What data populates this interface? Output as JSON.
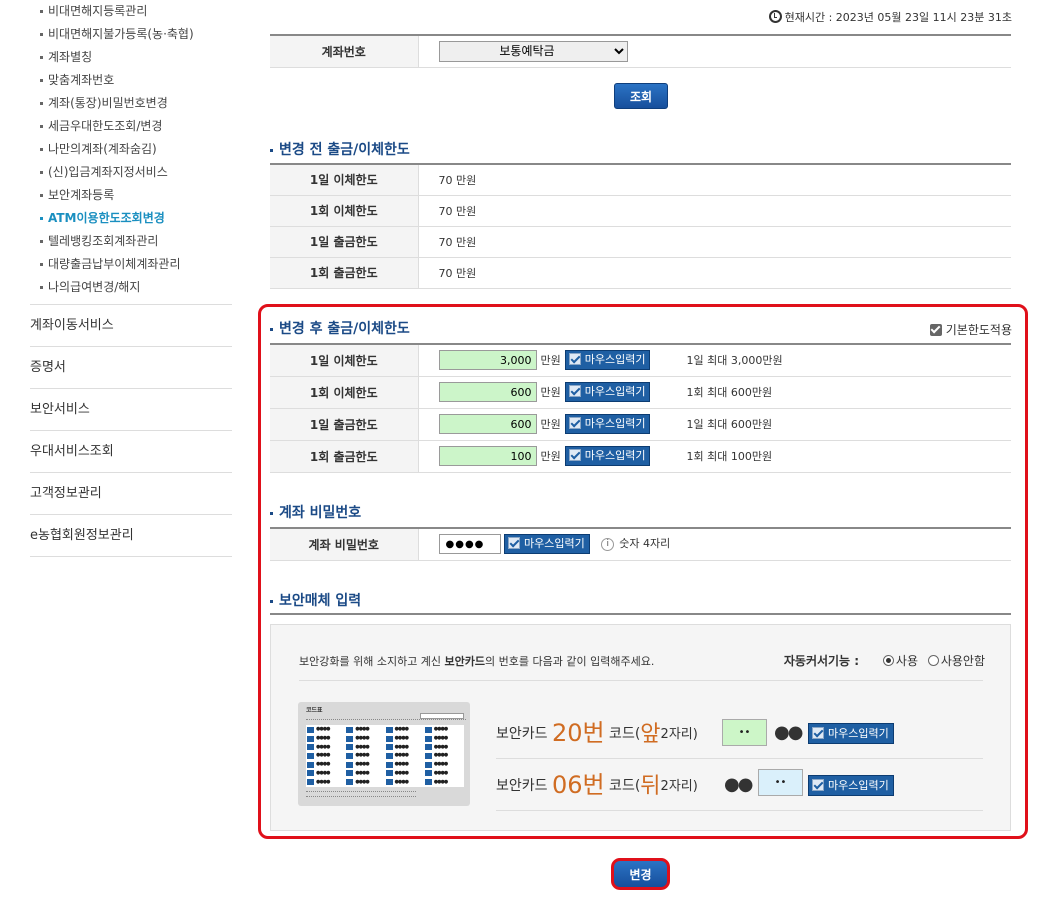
{
  "sidebar": {
    "sub_items": [
      {
        "label": "비대면해지등록관리",
        "active": false
      },
      {
        "label": "비대면해지불가등록(농·축협)",
        "active": false
      },
      {
        "label": "계좌별칭",
        "active": false
      },
      {
        "label": "맞춤계좌번호",
        "active": false
      },
      {
        "label": "계좌(통장)비밀번호변경",
        "active": false
      },
      {
        "label": "세금우대한도조회/변경",
        "active": false
      },
      {
        "label": "나만의계좌(계좌숨김)",
        "active": false
      },
      {
        "label": "(신)입금계좌지정서비스",
        "active": false
      },
      {
        "label": "보안계좌등록",
        "active": false
      },
      {
        "label": "ATM이용한도조회변경",
        "active": true
      },
      {
        "label": "텔레뱅킹조회계좌관리",
        "active": false
      },
      {
        "label": "대량출금납부이체계좌관리",
        "active": false
      },
      {
        "label": "나의급여변경/해지",
        "active": false
      }
    ],
    "main_items": [
      "계좌이동서비스",
      "증명서",
      "보안서비스",
      "우대서비스조회",
      "고객정보관리",
      "e농협회원정보관리"
    ]
  },
  "clock": {
    "text": "현재시간 : 2023년 05월 23일 11시 23분 31초"
  },
  "account": {
    "label": "계좌번호",
    "select_value": "보통예탁금"
  },
  "inquiry_button": "조회",
  "before": {
    "title": "변경 전 출금/이체한도",
    "rows": [
      {
        "label": "1일 이체한도",
        "value": "70 만원"
      },
      {
        "label": "1회 이체한도",
        "value": "70 만원"
      },
      {
        "label": "1일 출금한도",
        "value": "70 만원"
      },
      {
        "label": "1회 출금한도",
        "value": "70 만원"
      }
    ]
  },
  "after": {
    "title": "변경 후 출금/이체한도",
    "default_checkbox": "기본한도적용",
    "unit": "만원",
    "mouse_input": "마우스입력기",
    "rows": [
      {
        "label": "1일 이체한도",
        "value": "3,000",
        "hint": "1일 최대 3,000만원"
      },
      {
        "label": "1회 이체한도",
        "value": "600",
        "hint": "1회 최대 600만원"
      },
      {
        "label": "1일 출금한도",
        "value": "600",
        "hint": "1일 최대 600만원"
      },
      {
        "label": "1회 출금한도",
        "value": "100",
        "hint": "1회 최대 100만원"
      }
    ]
  },
  "password": {
    "title": "계좌 비밀번호",
    "label": "계좌 비밀번호",
    "masked": "●●●●",
    "mouse_input": "마우스입력기",
    "info_icon": "i",
    "info": "숫자 4자리"
  },
  "security": {
    "title": "보안매체 입력",
    "desc_pre": "보안강화를 위해 소지하고 계신 ",
    "desc_bold": "보안카드",
    "desc_post": "의 번호를 다음과 같이 입력해주세요.",
    "auto_cursor_label": "자동커서기능 :",
    "radio_use": "사용",
    "radio_nouse": "사용안함",
    "card_title": "코드표",
    "code1": {
      "prefix": "보안카드 ",
      "num": "20번",
      "mid": " 코드(",
      "pos": "앞",
      "suffix": "2자리)",
      "value": "••",
      "dots": "●●"
    },
    "code2": {
      "prefix": "보안카드 ",
      "num": "06번",
      "mid": " 코드(",
      "pos": "뒤",
      "suffix": "2자리)",
      "value": "••",
      "dots": "●●"
    },
    "mouse_input": "마우스입력기"
  },
  "change_button": "변경"
}
